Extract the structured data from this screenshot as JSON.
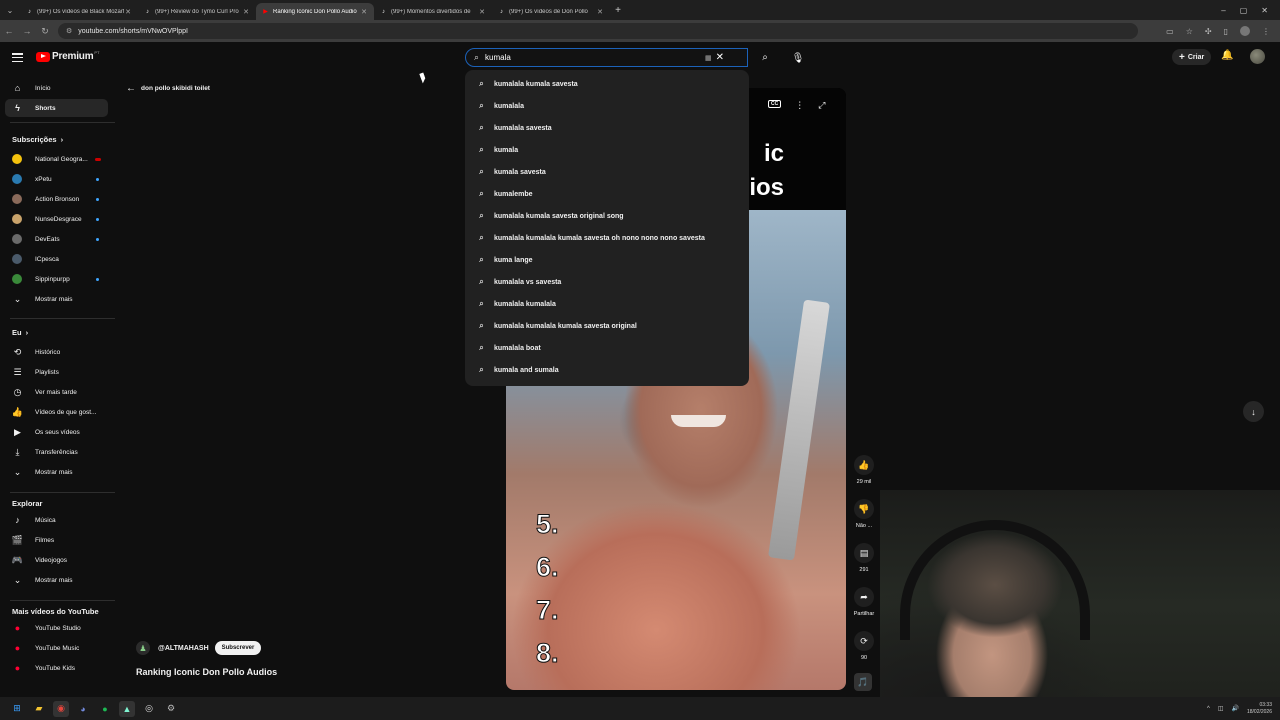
{
  "browser": {
    "tabs": [
      {
        "title": "(99+) Os vídeos de Black Mozart",
        "active": false,
        "favicon": "tiktok-icon"
      },
      {
        "title": "(99+) Review do Tymo Curl Pro",
        "active": false,
        "favicon": "tiktok-icon"
      },
      {
        "title": "Ranking Iconic Don Pollo Audio",
        "active": true,
        "favicon": "youtube-icon"
      },
      {
        "title": "(99+) Momentos divertidos de",
        "active": false,
        "favicon": "tiktok-icon"
      },
      {
        "title": "(99+) Os vídeos de Don Pollo",
        "active": false,
        "favicon": "tiktok-icon"
      }
    ],
    "url": "youtube.com/shorts/mVNwOVPlppI"
  },
  "header": {
    "logo_text": "Premium",
    "logo_region": "PT",
    "search_value": "kumala",
    "create_label": "Criar"
  },
  "search_suggestions": [
    "kumalala kumala savesta",
    "kumalala",
    "kumalala savesta",
    "kumala",
    "kumala savesta",
    "kumalembe",
    "kumalala kumala savesta original song",
    "kumalala kumalala kumala savesta oh nono nono nono savesta",
    "kuma lange",
    "kumalala vs savesta",
    "kumalala kumalala",
    "kumalala kumalala kumala savesta original",
    "kumalala boat",
    "kumala and sumala"
  ],
  "sidebar": {
    "top": [
      {
        "label": "Início",
        "icon": "home-icon",
        "active": false
      },
      {
        "label": "Shorts",
        "icon": "shorts-icon",
        "active": true
      }
    ],
    "subscriptions_title": "Subscrições",
    "subscriptions": [
      {
        "label": "National Geogra...",
        "color": "#f4c20d",
        "badge": "live"
      },
      {
        "label": "xPetu",
        "color": "#2a7ab0",
        "badge": "dot"
      },
      {
        "label": "Action Bronson",
        "color": "#8a6a5a",
        "badge": "dot"
      },
      {
        "label": "NunseDesgrace",
        "color": "#c9a36b",
        "badge": "dot"
      },
      {
        "label": "DevEats",
        "color": "#6a6a6a",
        "badge": "dot"
      },
      {
        "label": "ICpesca",
        "color": "#4a5a6a",
        "badge": "none"
      },
      {
        "label": "Sippinpurpp",
        "color": "#3a8a3a",
        "badge": "dot"
      }
    ],
    "show_more": "Mostrar mais",
    "you_title": "Eu",
    "you_items": [
      {
        "label": "Histórico",
        "icon": "history-icon"
      },
      {
        "label": "Playlists",
        "icon": "playlists-icon"
      },
      {
        "label": "Ver mais tarde",
        "icon": "watch-later-icon"
      },
      {
        "label": "Vídeos de que gost...",
        "icon": "like-icon"
      },
      {
        "label": "Os seus vídeos",
        "icon": "your-videos-icon"
      },
      {
        "label": "Transferências",
        "icon": "download-icon"
      },
      {
        "label": "Mostrar mais",
        "icon": "chevron-down-icon"
      }
    ],
    "explore_title": "Explorar",
    "explore_items": [
      {
        "label": "Música",
        "icon": "music-icon"
      },
      {
        "label": "Filmes",
        "icon": "movies-icon"
      },
      {
        "label": "Videojogos",
        "icon": "gaming-icon"
      },
      {
        "label": "Mostrar mais",
        "icon": "chevron-down-icon"
      }
    ],
    "more_title": "Mais vídeos do YouTube",
    "more_items": [
      {
        "label": "YouTube Studio"
      },
      {
        "label": "YouTube Music"
      },
      {
        "label": "YouTube Kids"
      }
    ]
  },
  "main": {
    "back_label": "don pollo skibidi toilet",
    "video_title_lines": [
      "ic",
      "ios"
    ],
    "overlay_numbers": [
      "5.",
      "6.",
      "7.",
      "8."
    ],
    "channel_name": "@ALTMAHASH",
    "subscribe_label": "Subscrever",
    "short_title": "Ranking Iconic Don Pollo Audios"
  },
  "actions": {
    "likes": "29 mil",
    "dislike": "Não ...",
    "comments": "291",
    "share": "Partilhar",
    "remix": "90"
  },
  "taskbar": {
    "time": "03:33",
    "date": "18/02/2026"
  }
}
